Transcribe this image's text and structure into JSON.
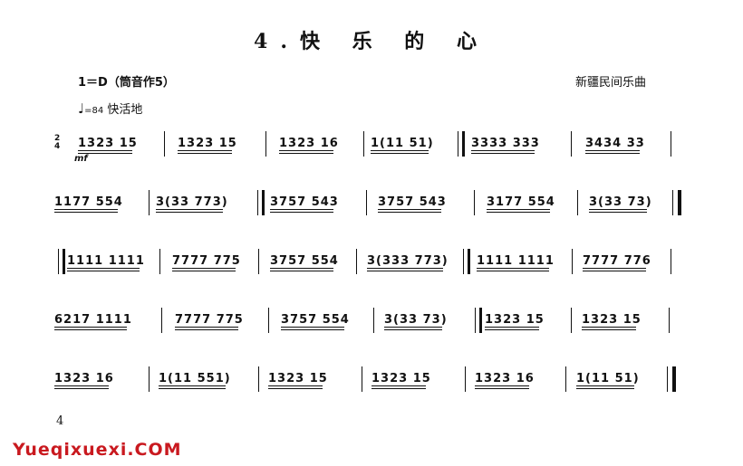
{
  "title": "4.快 乐 的 心",
  "key": "1＝D（筒音作5）",
  "source": "新疆民间乐曲",
  "tempo": {
    "note": "♩",
    "bpm": "=84",
    "expression": "快活地"
  },
  "time_signature": {
    "top": "2",
    "bottom": "4"
  },
  "dynamic": "mf",
  "lines": [
    [
      "1323  15",
      "1323  15",
      "1323  16",
      "1(11  51)",
      "3333  333",
      "3434  33"
    ],
    [
      "1177  554",
      "3(33  773)",
      "3757  543",
      "3757  543",
      "3177  554",
      "3(33  73)"
    ],
    [
      "1111  1111",
      "7777  775",
      "3757  554",
      "3(333  773)",
      "1111  1111",
      "7777  776"
    ],
    [
      "6217  1111",
      "7777  775",
      "3757  554",
      "3(33  73)",
      "1323  15",
      "1323  15"
    ],
    [
      "1323  16",
      "1(11  551)",
      "1323  15",
      "1323  15",
      "1323  16",
      "1(11  51)"
    ]
  ],
  "page_number": "4",
  "watermark": "Yueqixuexi.COM"
}
